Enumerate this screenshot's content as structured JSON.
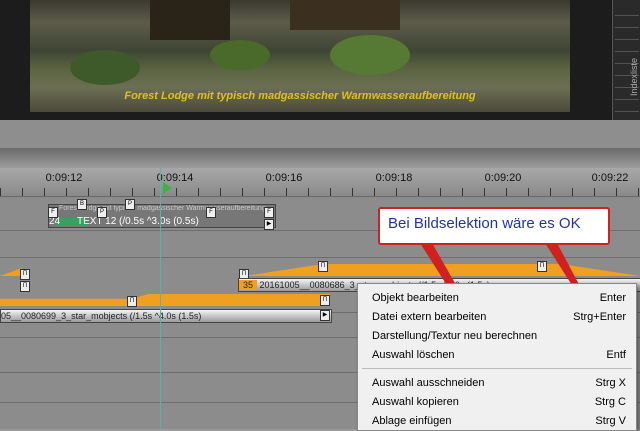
{
  "preview": {
    "caption": "Forest Lodge mit typisch madgassischer Warmwasseraufbereitung",
    "side_label": "Indexliste"
  },
  "ruler": {
    "ticks": [
      "0:09:12",
      "0:09:14",
      "0:09:16",
      "0:09:18",
      "0:09:20",
      "0:09:22"
    ]
  },
  "tracks": {
    "text_clip": {
      "number": "24",
      "label": "TEXT 12 (/0.5s ^3.0s (0.5s)",
      "overlay": "Forest Lodge mit typisch madgassischer Warmwasseraufbereitung"
    },
    "clip_a": {
      "label": "05__0080699_3_star_mobjects (/1.5s ^4.0s (1.5s)"
    },
    "clip_b": {
      "number": "35",
      "label": "20161005__0080686_3_star_mobjects (/1.5s ^4.0s (1.5s)"
    }
  },
  "callout": {
    "text": "Bei Bildselektion wäre es OK",
    "color": "#d02020"
  },
  "context_menu": {
    "group1": [
      {
        "label": "Objekt bearbeiten",
        "shortcut": "Enter"
      },
      {
        "label": "Datei extern bearbeiten",
        "shortcut": "Strg+Enter"
      },
      {
        "label": "Darstellung/Textur neu berechnen",
        "shortcut": ""
      },
      {
        "label": "Auswahl löschen",
        "shortcut": "Entf"
      }
    ],
    "group2": [
      {
        "label": "Auswahl ausschneiden",
        "shortcut": "Strg X"
      },
      {
        "label": "Auswahl kopieren",
        "shortcut": "Strg C"
      },
      {
        "label": "Ablage einfügen",
        "shortcut": "Strg V"
      }
    ]
  },
  "colors": {
    "accent_orange": "#f0a020",
    "playhead": "#3fb23f",
    "caption": "#e0c020"
  }
}
